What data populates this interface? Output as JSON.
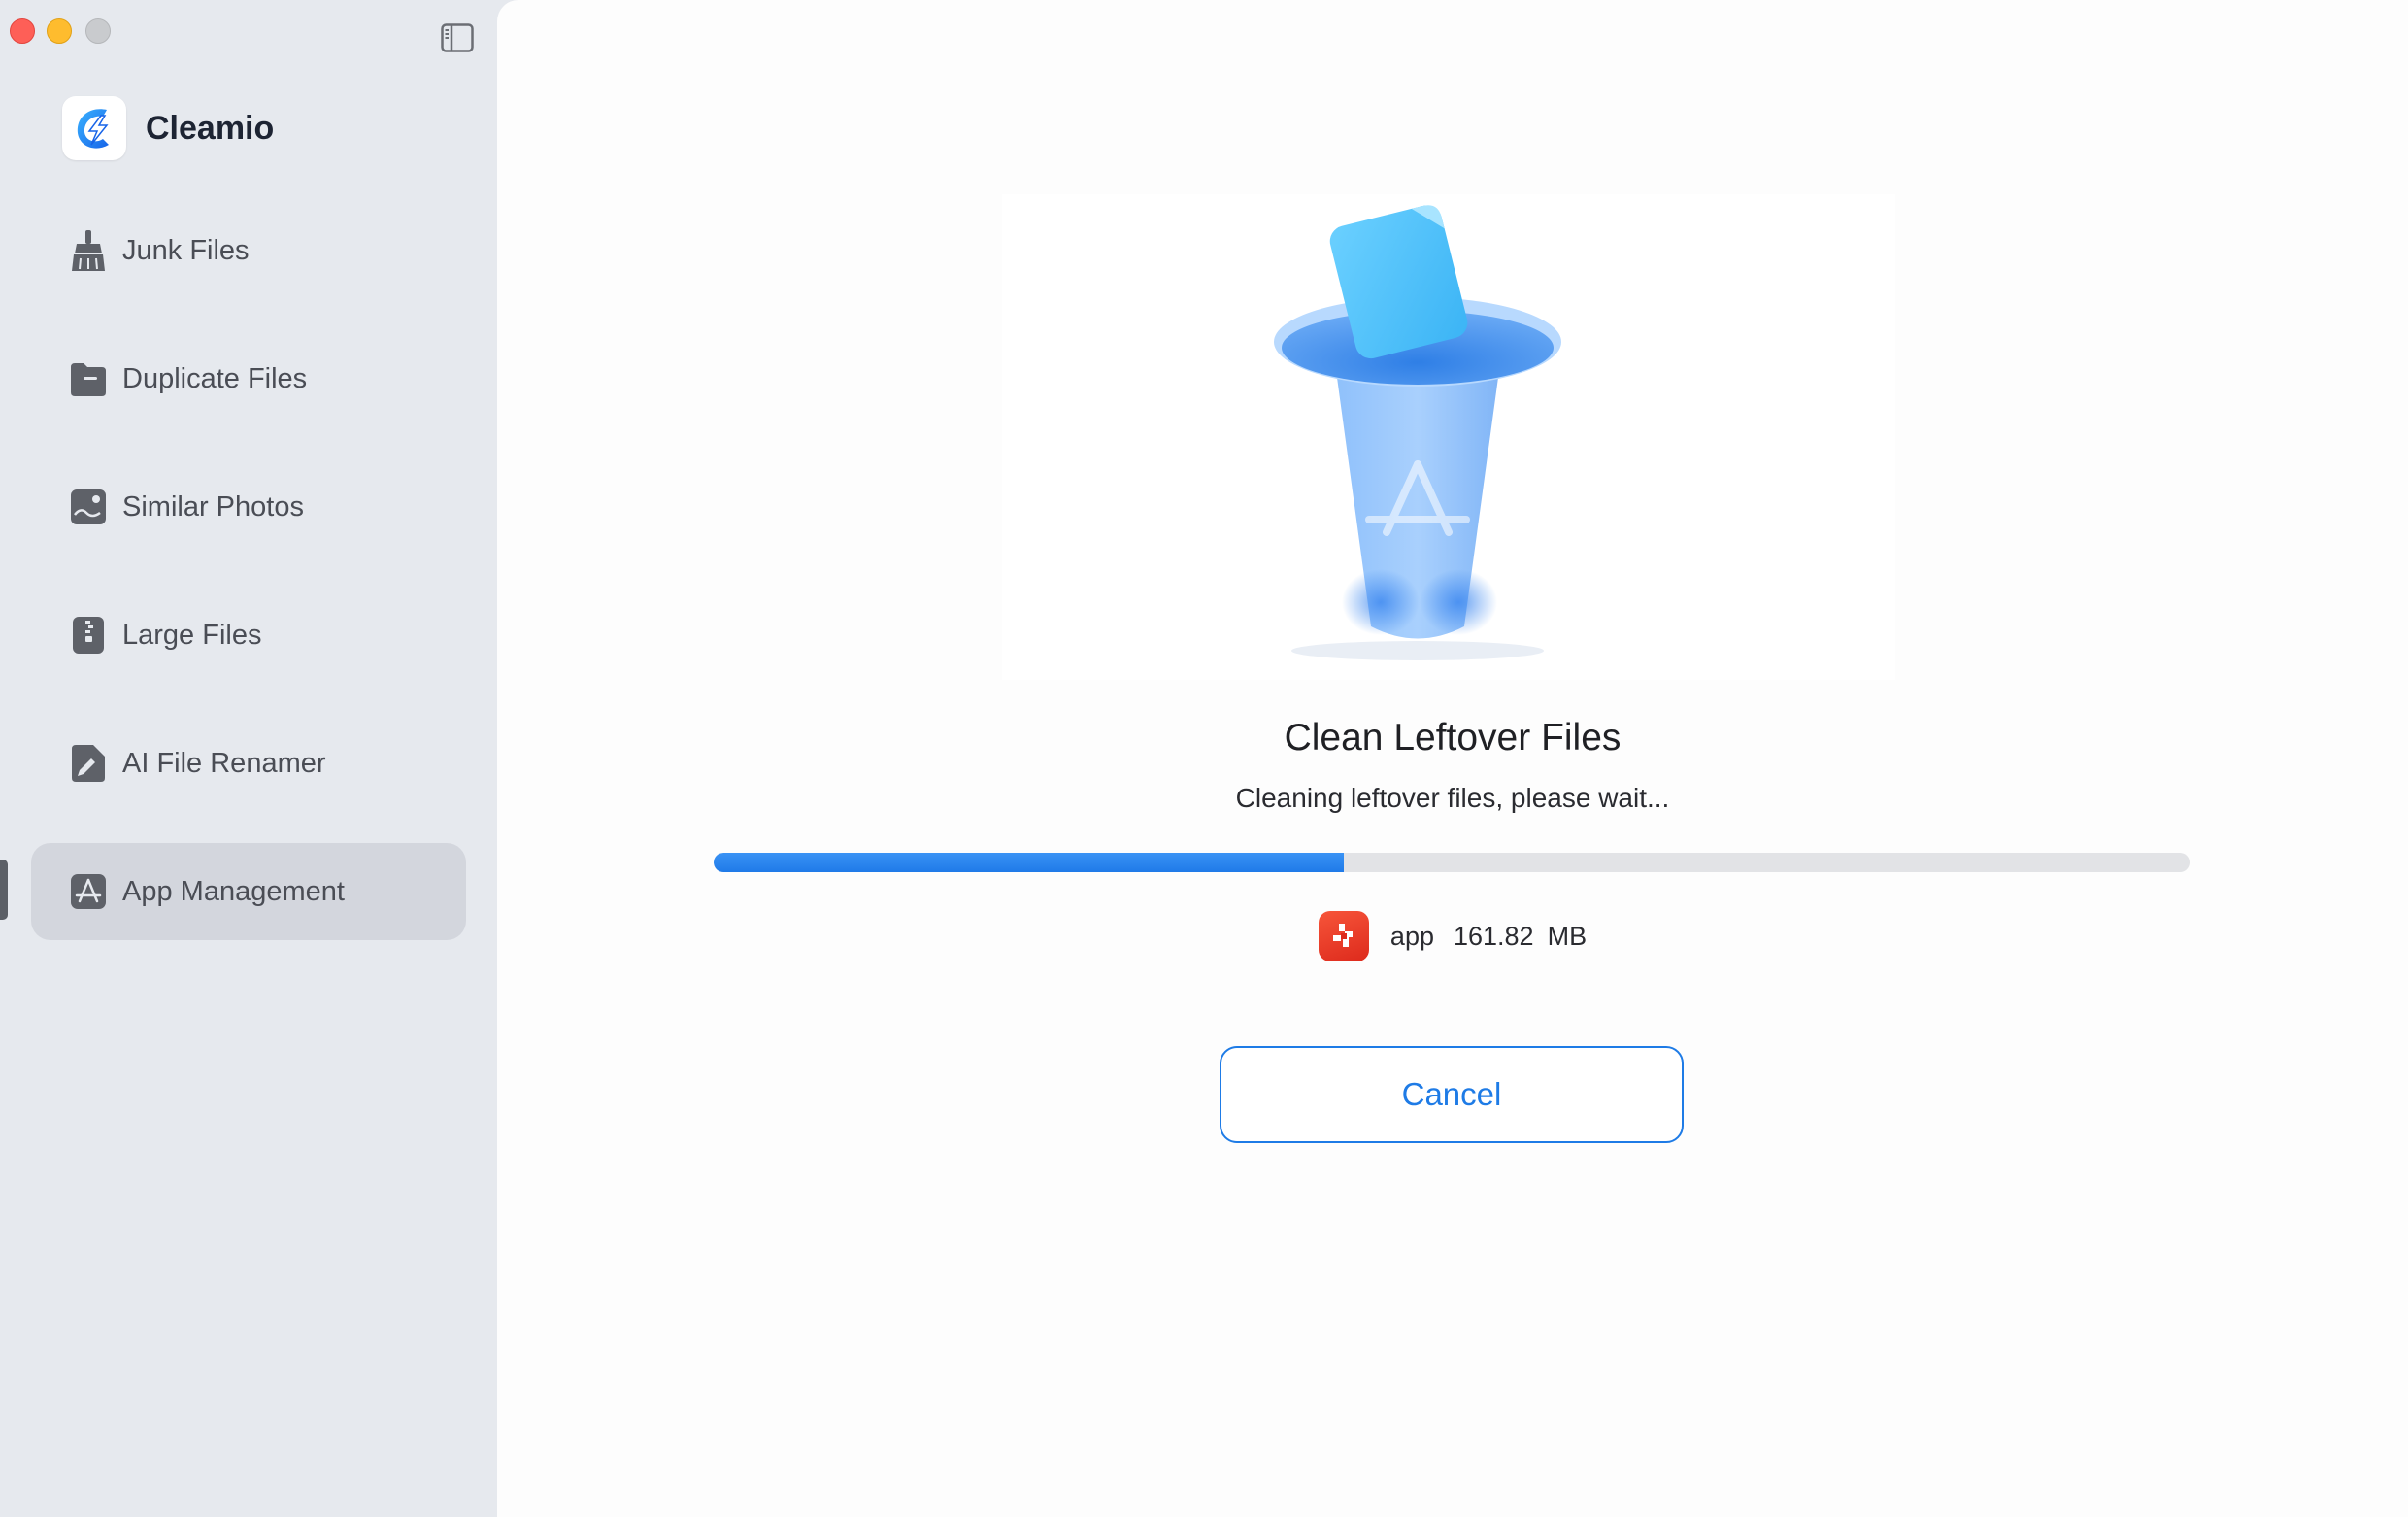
{
  "window": {
    "traffic_lights": [
      "close",
      "minimize",
      "zoom"
    ]
  },
  "sidebar": {
    "toggle_icon": "sidebar-toggle-icon",
    "brand": {
      "name": "Cleamio",
      "logo_icon": "cleamio-logo-icon",
      "accent": "#1e7be6"
    },
    "items": [
      {
        "label": "Junk Files",
        "icon": "broom-icon",
        "active": false
      },
      {
        "label": "Duplicate Files",
        "icon": "folder-icon",
        "active": false
      },
      {
        "label": "Similar Photos",
        "icon": "photo-icon",
        "active": false
      },
      {
        "label": "Large Files",
        "icon": "zip-file-icon",
        "active": false
      },
      {
        "label": "AI File Renamer",
        "icon": "file-rename-icon",
        "active": false
      },
      {
        "label": "App Management",
        "icon": "app-store-icon",
        "active": true
      }
    ]
  },
  "main": {
    "illustration_icon": "trash-can-icon",
    "title": "Clean Leftover Files",
    "subtitle": "Cleaning leftover files, please wait...",
    "progress": {
      "fraction": 0.427,
      "color": "#1f7ae8",
      "track_color": "#e2e3e6"
    },
    "current_file": {
      "name": "app",
      "size": "161.82",
      "unit": "MB",
      "icon": "app-icon"
    },
    "cancel_label": "Cancel"
  }
}
